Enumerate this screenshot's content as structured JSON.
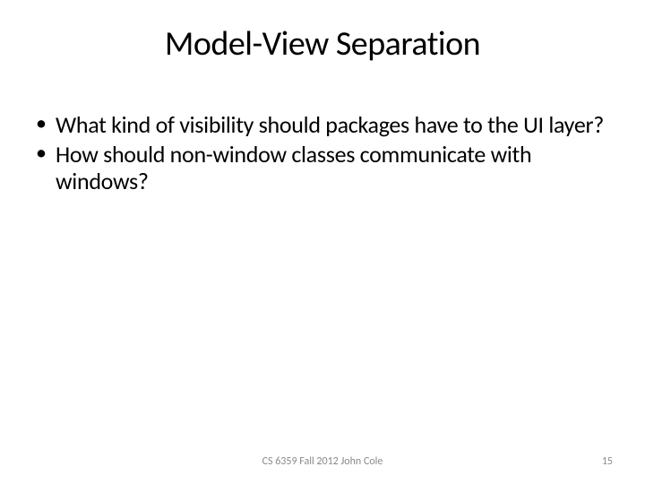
{
  "title": "Model-View Separation",
  "bullets": [
    "What kind of visibility should packages have to the UI layer?",
    "How should non-window classes communicate with windows?"
  ],
  "footer": {
    "center": "CS 6359 Fall 2012 John Cole",
    "page": "15"
  }
}
